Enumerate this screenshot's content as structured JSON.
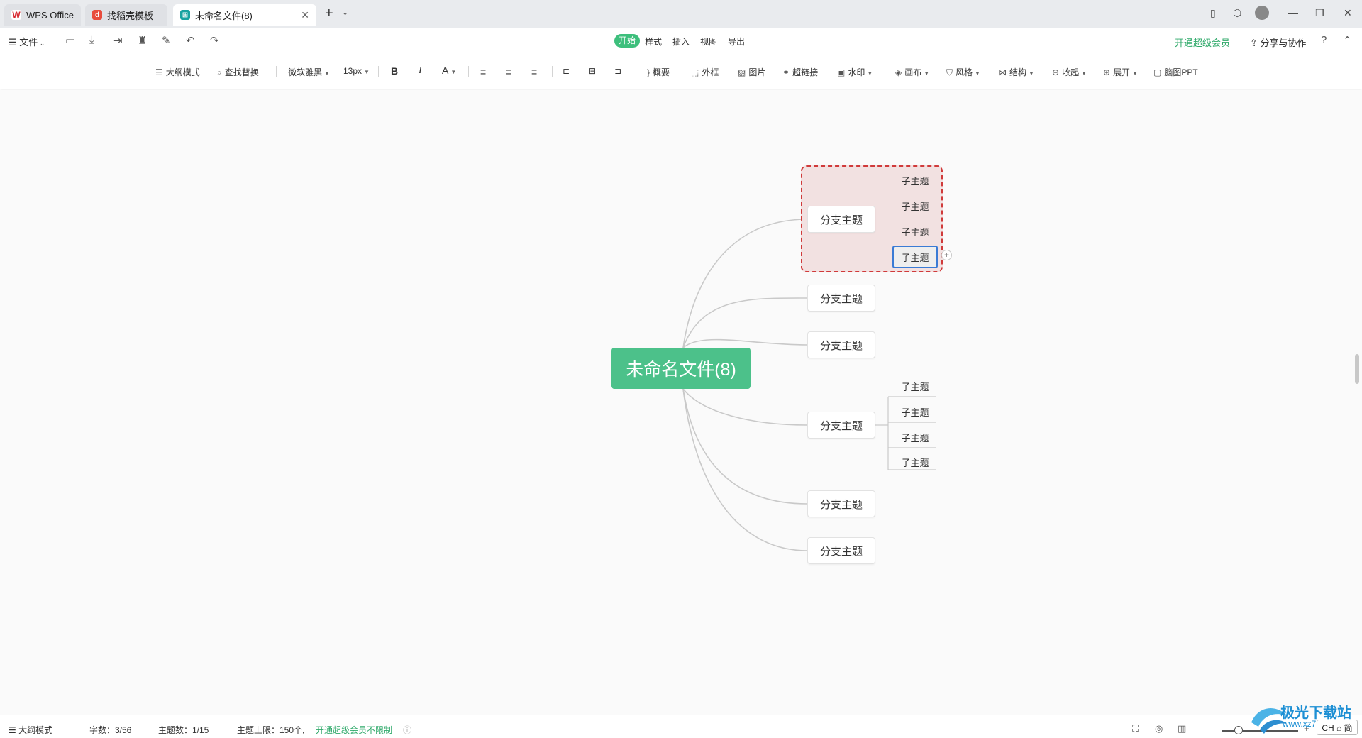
{
  "tabs": [
    {
      "label": "WPS Office",
      "icon": "wps-logo-icon"
    },
    {
      "label": "找稻壳模板",
      "icon": "docer-icon"
    },
    {
      "label": "未命名文件(8)",
      "icon": "mindmap-file-icon",
      "active": true
    }
  ],
  "menu": {
    "file_label": "文件",
    "tabs": [
      "开始",
      "样式",
      "插入",
      "视图",
      "导出"
    ],
    "active_tab": "开始",
    "vip_label": "开通超级会员",
    "share_label": "分享与协作"
  },
  "toolbar": {
    "outline_mode": "大纲模式",
    "find_replace": "查找替换",
    "font_family": "微软雅黑",
    "font_size": "13px",
    "bold": "B",
    "italic": "I",
    "font_color": "A",
    "summary": "概要",
    "outer_frame": "外框",
    "image": "图片",
    "hyperlink": "超链接",
    "watermark": "水印",
    "canvas": "画布",
    "style": "风格",
    "structure": "结构",
    "collapse": "收起",
    "expand": "展开",
    "mindmap_ppt": "脑图PPT"
  },
  "mindmap": {
    "root": "未命名文件(8)",
    "branches": [
      {
        "label": "分支主题",
        "children": [
          "子主题",
          "子主题",
          "子主题",
          "子主题"
        ],
        "selected_child": 3,
        "highlighted": true
      },
      {
        "label": "分支主题",
        "children": []
      },
      {
        "label": "分支主题",
        "children": []
      },
      {
        "label": "分支主题",
        "children": [
          "子主题",
          "子主题",
          "子主题",
          "子主题"
        ]
      },
      {
        "label": "分支主题",
        "children": []
      },
      {
        "label": "分支主题",
        "children": []
      }
    ],
    "add_child": "+"
  },
  "status": {
    "outline_mode": "大纲模式",
    "word_count": "字数：3/56",
    "topic_count": "主题数：1/15",
    "topic_limit": "主题上限：150个,",
    "vip_unlimited": "开通超级会员不限制"
  },
  "watermark": {
    "site": "极光下载站",
    "url": "www.xz7.com"
  },
  "ime": "CH ⌂ 简",
  "colors": {
    "accent": "#4cc18a",
    "vip": "#2fa96a",
    "selection": "#3a7bd5",
    "boundary": "#d03a3a"
  }
}
